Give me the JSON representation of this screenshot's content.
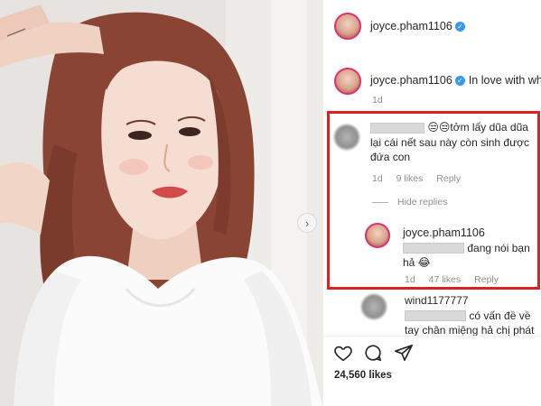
{
  "post": {
    "next_glyph": "›"
  },
  "header": {
    "username": "joyce.pham1106"
  },
  "caption": {
    "username": "joyce.pham1106",
    "text": "In love with white",
    "time": "1d"
  },
  "comments": [
    {
      "text_line1": "😒😒tởm lấy dũa dũa",
      "text_line2": "lại cái nết sau này còn sinh được",
      "text_line3": "đứa con",
      "time": "1d",
      "likes": "9 likes",
      "reply": "Reply"
    }
  ],
  "hide_replies": "Hide replies",
  "reply_comment": {
    "username": "joyce.pham1106",
    "text_line1": "đang nói bạn",
    "text_line2": "hả 😂",
    "time": "1d",
    "likes": "47 likes",
    "reply": "Reply"
  },
  "third_comment": {
    "username": "wind1177777",
    "text_line1": "có vấn đề về",
    "text_line2": "tay chân miệng hả chị phát"
  },
  "actions": {
    "likes_count": "24,560 likes",
    "icons": [
      "heart-icon",
      "comment-icon",
      "share-icon"
    ]
  },
  "colors": {
    "verified": "#3897f0",
    "highlight": "#e02020",
    "muted_text": "#8e8e8e"
  }
}
